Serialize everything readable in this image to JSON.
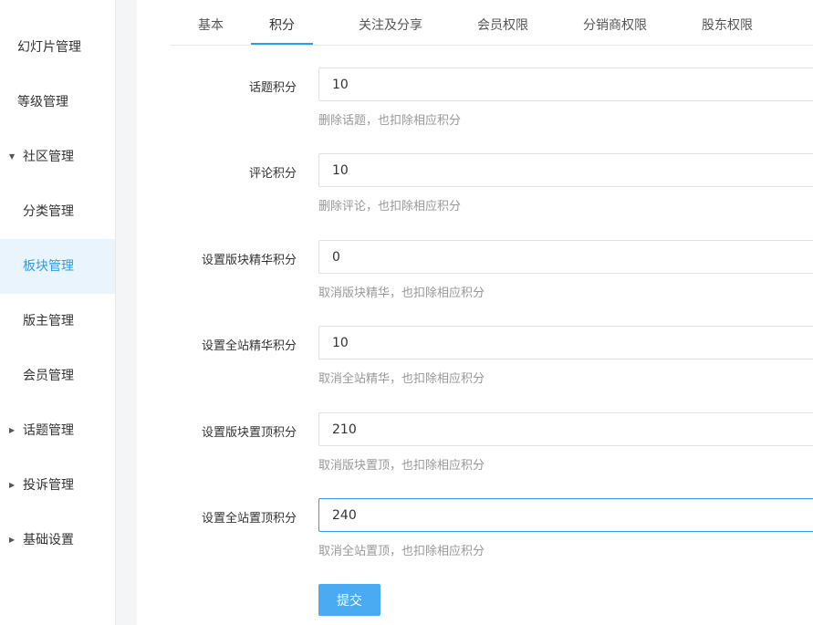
{
  "sidebar": {
    "items": [
      {
        "label": "幻灯片管理"
      },
      {
        "label": "等级管理"
      },
      {
        "label": "社区管理",
        "caret": "▼"
      },
      {
        "label": "分类管理"
      },
      {
        "label": "板块管理"
      },
      {
        "label": "版主管理"
      },
      {
        "label": "会员管理"
      },
      {
        "label": "话题管理",
        "caret": "▶"
      },
      {
        "label": "投诉管理",
        "caret": "▶"
      },
      {
        "label": "基础设置",
        "caret": "▶"
      }
    ]
  },
  "tabs": [
    {
      "label": "基本"
    },
    {
      "label": "积分"
    },
    {
      "label": "关注及分享"
    },
    {
      "label": "会员权限"
    },
    {
      "label": "分销商权限"
    },
    {
      "label": "股东权限"
    }
  ],
  "form": {
    "rows": [
      {
        "label": "话题积分",
        "value": "10",
        "hint": "删除话题，也扣除相应积分"
      },
      {
        "label": "评论积分",
        "value": "10",
        "hint": "删除评论，也扣除相应积分"
      },
      {
        "label": "设置版块精华积分",
        "value": "0",
        "hint": "取消版块精华，也扣除相应积分"
      },
      {
        "label": "设置全站精华积分",
        "value": "10",
        "hint": "取消全站精华，也扣除相应积分"
      },
      {
        "label": "设置版块置顶积分",
        "value": "210",
        "hint": "取消版块置顶，也扣除相应积分"
      },
      {
        "label": "设置全站置顶积分",
        "value": "240",
        "hint": "取消全站置顶，也扣除相应积分"
      }
    ],
    "submit_label": "提交"
  },
  "colors": {
    "accent": "#2f9bf0",
    "button": "#4aabf3",
    "active_bg": "#eaf4fd",
    "hint": "#999999"
  }
}
